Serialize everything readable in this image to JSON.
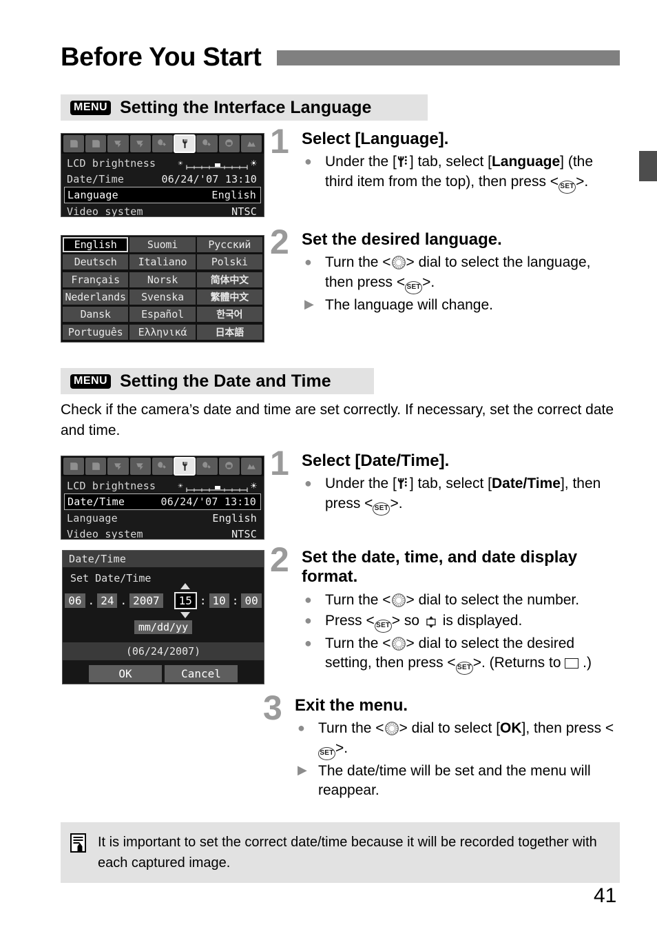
{
  "page": {
    "chapter_title": "Before You Start",
    "folio": "41"
  },
  "sections": [
    {
      "badge": "MENU",
      "title": "Setting the Interface Language"
    },
    {
      "badge": "MENU",
      "title": "Setting the Date and Time",
      "intro": "Check if the camera’s date and time are set correctly. If necessary, set the correct date and time."
    }
  ],
  "lcd_menu_language": {
    "tabs": [
      "shoot1-icon",
      "shoot2-icon",
      "playback1-icon",
      "playback2-icon",
      "setup1-icon",
      "setup2-icon",
      "setup3-icon",
      "custom-icon",
      "mymenu-icon"
    ],
    "selected_tab_index": 5,
    "rows": [
      {
        "label": "LCD brightness",
        "value": "",
        "type": "slider",
        "highlighted": false
      },
      {
        "label": "Date/Time",
        "value": "06/24/'07 13:10",
        "type": "text",
        "highlighted": false
      },
      {
        "label": "Language",
        "value": "English",
        "type": "text",
        "highlighted": true
      },
      {
        "label": "Video system",
        "value": "NTSC",
        "type": "text",
        "highlighted": false
      }
    ]
  },
  "lcd_menu_datetime": {
    "tabs": [
      "shoot1-icon",
      "shoot2-icon",
      "playback1-icon",
      "playback2-icon",
      "setup1-icon",
      "setup2-icon",
      "setup3-icon",
      "custom-icon",
      "mymenu-icon"
    ],
    "selected_tab_index": 5,
    "rows": [
      {
        "label": "LCD brightness",
        "value": "",
        "type": "slider",
        "highlighted": false
      },
      {
        "label": "Date/Time",
        "value": "06/24/'07 13:10",
        "type": "text",
        "highlighted": true
      },
      {
        "label": "Language",
        "value": "English",
        "type": "text",
        "highlighted": false
      },
      {
        "label": "Video system",
        "value": "NTSC",
        "type": "text",
        "highlighted": false
      }
    ]
  },
  "language_grid": {
    "selected": "English",
    "cells": [
      {
        "label": "English",
        "cjk": false
      },
      {
        "label": "Suomi",
        "cjk": false
      },
      {
        "label": "Русский",
        "cjk": false
      },
      {
        "label": "Deutsch",
        "cjk": false
      },
      {
        "label": "Italiano",
        "cjk": false
      },
      {
        "label": "Polski",
        "cjk": false
      },
      {
        "label": "Français",
        "cjk": false
      },
      {
        "label": "Norsk",
        "cjk": false
      },
      {
        "label": "简体中文",
        "cjk": true
      },
      {
        "label": "Nederlands",
        "cjk": false
      },
      {
        "label": "Svenska",
        "cjk": false
      },
      {
        "label": "繁體中文",
        "cjk": true
      },
      {
        "label": "Dansk",
        "cjk": false
      },
      {
        "label": "Español",
        "cjk": false
      },
      {
        "label": "한국어",
        "cjk": true
      },
      {
        "label": "Português",
        "cjk": false
      },
      {
        "label": "Ελληνικά",
        "cjk": false
      },
      {
        "label": "日本語",
        "cjk": true
      }
    ]
  },
  "datetime_dialog": {
    "title": "Date/Time",
    "subtitle": "Set Date/Time",
    "month": "06",
    "day": "24",
    "year": "2007",
    "hour": "15",
    "minute": "10",
    "second": "00",
    "format": "mm/dd/yy",
    "preview": "(06/24/2007)",
    "ok_label": "OK",
    "cancel_label": "Cancel"
  },
  "steps_language": [
    {
      "num": "1",
      "title": "Select [Language].",
      "bullets": [
        {
          "marker": "dot",
          "parts": [
            {
              "t": "text",
              "v": "Under the ["
            },
            {
              "t": "icon",
              "v": "wrench-icon"
            },
            {
              "t": "text",
              "v": "] tab, select ["
            },
            {
              "t": "bold",
              "v": "Language"
            },
            {
              "t": "text",
              "v": "] (the third item from the top), then press <"
            },
            {
              "t": "icon",
              "v": "set-icon"
            },
            {
              "t": "text",
              "v": ">."
            }
          ]
        }
      ]
    },
    {
      "num": "2",
      "title": "Set the desired language.",
      "bullets": [
        {
          "marker": "dot",
          "parts": [
            {
              "t": "text",
              "v": "Turn the <"
            },
            {
              "t": "icon",
              "v": "dial-icon"
            },
            {
              "t": "text",
              "v": "> dial to select the language, then press <"
            },
            {
              "t": "icon",
              "v": "set-icon"
            },
            {
              "t": "text",
              "v": ">."
            }
          ]
        },
        {
          "marker": "tri",
          "parts": [
            {
              "t": "text",
              "v": "The language will change."
            }
          ]
        }
      ]
    }
  ],
  "steps_datetime": [
    {
      "num": "1",
      "title": "Select [Date/Time].",
      "bullets": [
        {
          "marker": "dot",
          "parts": [
            {
              "t": "text",
              "v": "Under the ["
            },
            {
              "t": "icon",
              "v": "wrench-icon"
            },
            {
              "t": "text",
              "v": "] tab, select ["
            },
            {
              "t": "bold",
              "v": "Date/Time"
            },
            {
              "t": "text",
              "v": "], then press <"
            },
            {
              "t": "icon",
              "v": "set-icon"
            },
            {
              "t": "text",
              "v": ">."
            }
          ]
        }
      ]
    },
    {
      "num": "2",
      "title": "Set the date, time, and date display format.",
      "bullets": [
        {
          "marker": "dot",
          "parts": [
            {
              "t": "text",
              "v": "Turn the <"
            },
            {
              "t": "icon",
              "v": "dial-icon"
            },
            {
              "t": "text",
              "v": "> dial to select the number."
            }
          ]
        },
        {
          "marker": "dot",
          "parts": [
            {
              "t": "text",
              "v": "Press <"
            },
            {
              "t": "icon",
              "v": "set-icon"
            },
            {
              "t": "text",
              "v": "> so "
            },
            {
              "t": "icon",
              "v": "box-arrow-icon"
            },
            {
              "t": "text",
              "v": " is displayed."
            }
          ]
        },
        {
          "marker": "dot",
          "parts": [
            {
              "t": "text",
              "v": "Turn the <"
            },
            {
              "t": "icon",
              "v": "dial-icon"
            },
            {
              "t": "text",
              "v": "> dial to select the desired setting, then press <"
            },
            {
              "t": "icon",
              "v": "set-icon"
            },
            {
              "t": "text",
              "v": ">. (Returns to "
            },
            {
              "t": "icon",
              "v": "box-icon"
            },
            {
              "t": "text",
              "v": " .)"
            }
          ]
        }
      ]
    },
    {
      "num": "3",
      "title": "Exit the menu.",
      "bullets": [
        {
          "marker": "dot",
          "parts": [
            {
              "t": "text",
              "v": "Turn the <"
            },
            {
              "t": "icon",
              "v": "dial-icon"
            },
            {
              "t": "text",
              "v": "> dial to select ["
            },
            {
              "t": "bold",
              "v": "OK"
            },
            {
              "t": "text",
              "v": "], then press <"
            },
            {
              "t": "icon",
              "v": "set-icon"
            },
            {
              "t": "text",
              "v": ">."
            }
          ]
        },
        {
          "marker": "tri",
          "parts": [
            {
              "t": "text",
              "v": "The date/time will be set and the menu will reappear."
            }
          ]
        }
      ]
    }
  ],
  "note": {
    "icon": "memo-icon",
    "text": "It is important to set the correct date/time because it will be recorded together with each captured image."
  },
  "colors": {
    "section_bar": "#e2e2e2",
    "chapter_rule": "#808080",
    "step_number": "#9a9a9a",
    "side_tab": "#4d4d4d",
    "lcd_background": "#1a1a1a"
  }
}
